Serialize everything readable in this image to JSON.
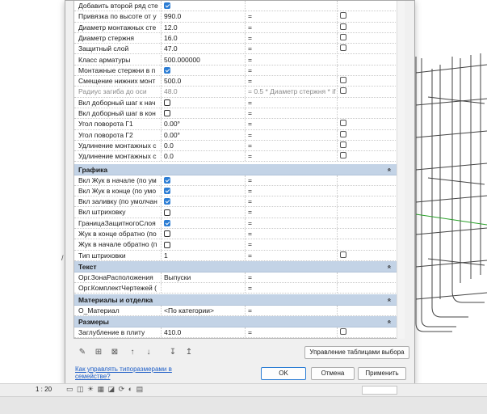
{
  "properties": {
    "rows_top": [
      {
        "name": "Добавить второй ряд сте",
        "value": "",
        "value_checked": true,
        "formula": "",
        "instance": null,
        "greyed": false
      },
      {
        "name": "Привязка по высоте от у",
        "value": "990.0",
        "formula": "=",
        "instance": false
      },
      {
        "name": "Диаметр монтажных сте",
        "value": "12.0",
        "formula": "=",
        "instance": false
      },
      {
        "name": "Диаметр стержня",
        "value": "16.0",
        "formula": "=",
        "instance": false
      },
      {
        "name": "Защитный слой",
        "value": "47.0",
        "formula": "=",
        "instance": false
      },
      {
        "name": "Класс арматуры",
        "value": "500.000000",
        "formula": "=",
        "instance": null
      },
      {
        "name": "Монтажные стержни в п",
        "value": "",
        "value_checked": true,
        "formula": "=",
        "instance": null
      },
      {
        "name": "Смещение нижних монт",
        "value": "500.0",
        "formula": "=",
        "instance": false
      },
      {
        "name": "Радиус загиба до оси",
        "value": "48.0",
        "formula": "= 0.5 * Диаметр стержня * if",
        "instance": false,
        "greyed": true
      },
      {
        "name": "Вкл доборный шаг к нач",
        "value": "",
        "value_checked": false,
        "formula": "=",
        "instance": null
      },
      {
        "name": "Вкл доборный шаг в кон",
        "value": "",
        "value_checked": false,
        "formula": "=",
        "instance": null
      },
      {
        "name": "Угол поворота Г1",
        "value": "0.00°",
        "formula": "=",
        "instance": false
      },
      {
        "name": "Угол поворота Г2",
        "value": "0.00°",
        "formula": "=",
        "instance": false
      },
      {
        "name": "Удлинение монтажных с",
        "value": "0.0",
        "formula": "=",
        "instance": false
      },
      {
        "name": "Удлинение монтажных с",
        "value": "0.0",
        "formula": "=",
        "instance": false
      }
    ],
    "groups": [
      {
        "title": "Графика",
        "rows": [
          {
            "name": "Вкл Жук в начале (по ум",
            "value_checked": true,
            "formula": "=",
            "instance": null
          },
          {
            "name": "Вкл Жук в конце (по умо",
            "value_checked": true,
            "formula": "=",
            "instance": null
          },
          {
            "name": "Вкл заливку (по умолчан",
            "value_checked": true,
            "formula": "=",
            "instance": null
          },
          {
            "name": "Вкл штриховку",
            "value_checked": false,
            "formula": "=",
            "instance": null
          },
          {
            "name": "ГраницаЗащитногоСлоя",
            "value_checked": true,
            "formula": "=",
            "instance": null
          },
          {
            "name": "Жук в конце обратно (по",
            "value_checked": false,
            "formula": "=",
            "instance": null
          },
          {
            "name": "Жук в начале обратно (п",
            "value_checked": false,
            "formula": "=",
            "instance": null
          },
          {
            "name": "Тип штриховки",
            "value": "1",
            "formula": "=",
            "instance": false
          }
        ]
      },
      {
        "title": "Текст",
        "rows": [
          {
            "name": "Орг.ЗонаРасположения",
            "value": "Выпуски",
            "formula": "=",
            "instance": null
          },
          {
            "name": "Орг.КомплектЧертежей (",
            "value": "",
            "formula": "=",
            "instance": null
          }
        ]
      },
      {
        "title": "Материалы и отделка",
        "rows": [
          {
            "name": "О_Материал",
            "value": "<По категории>",
            "formula": "=",
            "instance": null
          }
        ]
      },
      {
        "title": "Размеры",
        "rows": [
          {
            "name": "Заглубление в плиту",
            "value": "410.0",
            "formula": "=",
            "instance": false
          }
        ]
      }
    ],
    "collapse_glyph": "»"
  },
  "toolbar": {
    "icons": [
      "pencil-icon",
      "new-parameter-icon",
      "delete-parameter-icon",
      "move-up-icon",
      "move-down-icon",
      "sort-ascending-icon",
      "sort-descending-icon"
    ],
    "manage_lookup_label": "Управление таблицами выбора"
  },
  "footer": {
    "help_link": "Как управлять типоразмерами в семействе?",
    "ok_label": "OK",
    "cancel_label": "Отмена",
    "apply_label": "Применить"
  },
  "statusbar": {
    "scale": "1 : 20"
  },
  "colors": {
    "group_header": "#c3d3e6",
    "checkbox_checked": "#2c7dd4",
    "link": "#2060c8",
    "axis_green": "#2aa02a"
  }
}
